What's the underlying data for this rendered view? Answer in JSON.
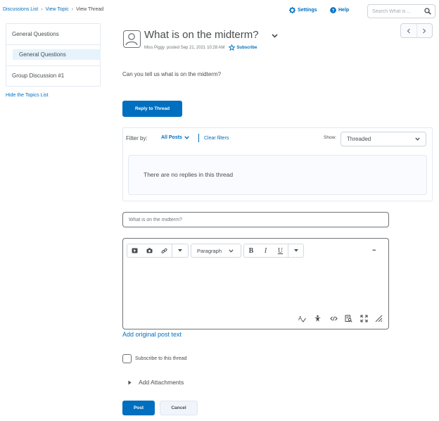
{
  "breadcrumb": {
    "items": [
      "Discussions List",
      "View Topic"
    ],
    "current": "View Thread",
    "separator": "›"
  },
  "header": {
    "settings_label": "Settings",
    "help_label": "Help",
    "search_placeholder": "Search What is ..."
  },
  "sidebar": {
    "category": "General Questions",
    "selected_topic": "General Questions",
    "group_topic": "Group Discussion #1",
    "hide_link": "Hide the Topics List"
  },
  "thread": {
    "title": "What is on the midterm?",
    "author": "Miss Piggy",
    "posted_text": "posted Sep 21, 2021 10:28 AM",
    "subscribe_label": "Subscribe",
    "body": "Can you tell us what is on the midterm?",
    "reply_button": "Reply to Thread"
  },
  "filters": {
    "label": "Filter by:",
    "selected": "All Posts",
    "clear_label": "Clear filters",
    "show_label": "Show:",
    "show_value": "Threaded",
    "empty_message": "There are no replies in this thread"
  },
  "reply_form": {
    "subject_value": "What is on the midterm?",
    "paragraph_value": "Paragraph",
    "bold_label": "B",
    "italic_label": "I",
    "underline_label": "U",
    "more_label": "...",
    "add_original_label": "Add original post text",
    "subscribe_label": "Subscribe to this thread",
    "attachments_label": "Add Attachments",
    "post_label": "Post",
    "cancel_label": "Cancel"
  },
  "colors": {
    "primary": "#006fbf",
    "selected_bg": "#e6f3fc",
    "text": "#494c4e",
    "border": "#e3e9f1"
  }
}
